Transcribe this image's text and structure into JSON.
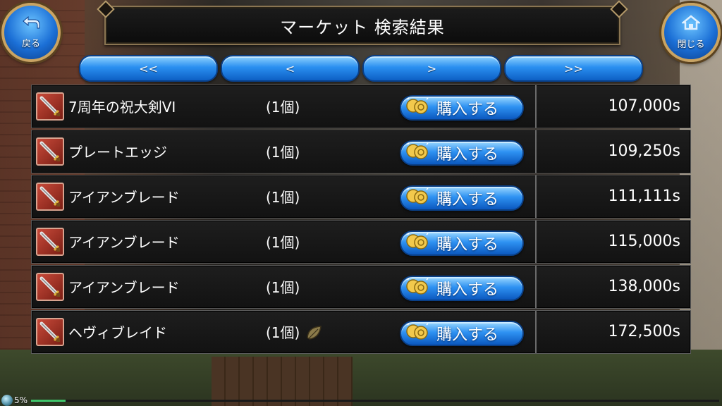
{
  "header": {
    "title": "マーケット 検索結果",
    "back_label": "戻る",
    "close_label": "閉じる"
  },
  "pager": {
    "first": "<<",
    "prev": "<",
    "next": ">",
    "last": ">>"
  },
  "buy_label": "購入する",
  "items": [
    {
      "name": "7周年の祝大剣VI",
      "qty": "(1個)",
      "price": "107,000s",
      "has_leaf": false
    },
    {
      "name": "プレートエッジ",
      "qty": "(1個)",
      "price": "109,250s",
      "has_leaf": false
    },
    {
      "name": "アイアンブレード",
      "qty": "(1個)",
      "price": "111,111s",
      "has_leaf": false
    },
    {
      "name": "アイアンブレード",
      "qty": "(1個)",
      "price": "115,000s",
      "has_leaf": false
    },
    {
      "name": "アイアンブレード",
      "qty": "(1個)",
      "price": "138,000s",
      "has_leaf": false
    },
    {
      "name": "ヘヴィブレイド",
      "qty": "(1個)",
      "price": "172,500s",
      "has_leaf": true
    }
  ],
  "status": {
    "percent_text": "5%",
    "progress": 0.05
  },
  "colors": {
    "accent_blue": "#2a8ff0",
    "frame_gold": "#c9a463",
    "row_bg": "#161616"
  },
  "icons": {
    "back": "back-arrow-icon",
    "close": "home-icon",
    "item": "sword-icon",
    "coin": "coin-icon",
    "leaf": "leaf-icon"
  }
}
